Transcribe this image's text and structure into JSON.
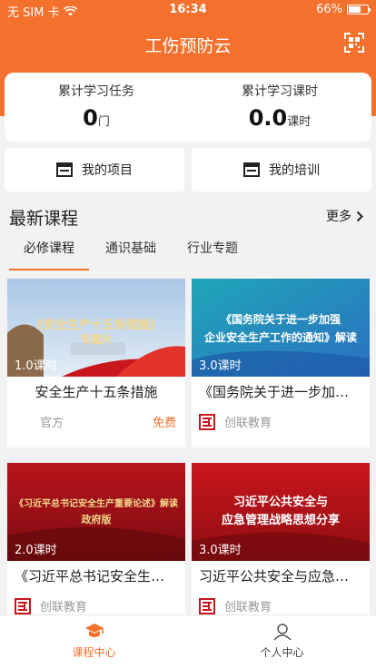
{
  "statusbar": {
    "carrier": "无 SIM 卡",
    "time": "16:34",
    "battery": "66%"
  },
  "app": {
    "title": "工伤预防云",
    "scan_icon": "qr-scan-icon"
  },
  "stats": [
    {
      "label": "累计学习任务",
      "value": "0",
      "unit": "门"
    },
    {
      "label": "累计学习课时",
      "value": "0.0",
      "unit": "课时"
    }
  ],
  "quick_links": [
    {
      "label": "我的项目",
      "icon": "document-icon"
    },
    {
      "label": "我的培训",
      "icon": "document-icon"
    }
  ],
  "section": {
    "title": "最新课程",
    "more": "更多"
  },
  "tabs": [
    {
      "label": "必修课程"
    },
    {
      "label": "通识基础"
    },
    {
      "label": "行业专题"
    }
  ],
  "courses": [
    {
      "title": "安全生产十五条措施",
      "hours": "1.0课时",
      "source": "官方",
      "price": "免费",
      "thumb_text": [
        "《安全生产十五条措施》",
        "专题片"
      ]
    },
    {
      "title": "《国务院关于进一步加强企业安全生产工作的通知》解读",
      "hours": "3.0课时",
      "source": "创联教育",
      "thumb_text": [
        "《国务院关于进一步加强",
        "企业安全生产工作的通知》解读"
      ]
    },
    {
      "title": "《习近平总书记安全生产重要论述》解读政府版",
      "hours": "2.0课时",
      "source": "创联教育",
      "thumb_text": [
        "《习近平总书记安全生产重要论述》解读",
        "政府版"
      ]
    },
    {
      "title": "习近平公共安全与应急管理战略思想分享",
      "hours": "3.0课时",
      "source": "创联教育",
      "thumb_text": [
        "习近平公共安全与",
        "应急管理战略思想分享"
      ]
    }
  ],
  "tabbar": [
    {
      "label": "课程中心",
      "icon": "course-center-icon"
    },
    {
      "label": "个人中心",
      "icon": "person-icon"
    }
  ],
  "colors": {
    "accent": "#f4702d"
  }
}
